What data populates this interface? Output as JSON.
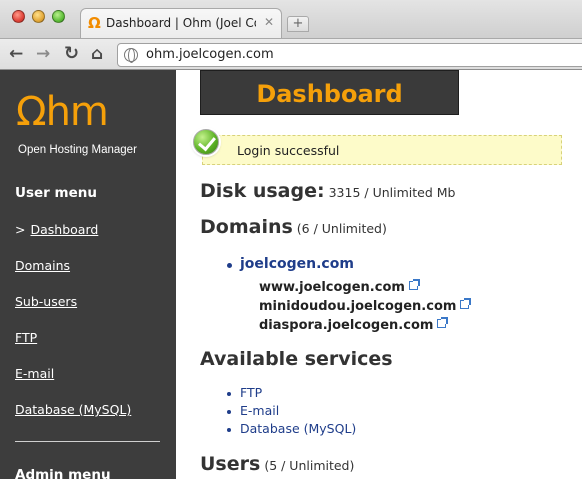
{
  "browser": {
    "tab_title": "Dashboard | Ohm (Joel Cogen)",
    "tab_favicon": "Ω",
    "tab_close": "✕",
    "new_tab": "+",
    "url": "ohm.joelcogen.com",
    "icons": [
      "back-arrow-icon",
      "forward-arrow-icon",
      "reload-icon",
      "home-icon",
      "globe-icon"
    ]
  },
  "sidebar": {
    "logo_mark": "Ωhm",
    "logo_sub": "Open Hosting Manager",
    "user_menu_heading": "User menu",
    "current_prefix": ">",
    "items": [
      {
        "label": "Dashboard"
      },
      {
        "label": "Domains"
      },
      {
        "label": "Sub-users"
      },
      {
        "label": "FTP"
      },
      {
        "label": "E-mail"
      },
      {
        "label": "Database (MySQL)"
      }
    ],
    "admin_menu_heading": "Admin menu"
  },
  "main": {
    "title": "Dashboard",
    "flash": "Login successful",
    "disk": {
      "heading": "Disk usage:",
      "value": "3315 / Unlimited Mb"
    },
    "domains": {
      "heading": "Domains",
      "count": "(6 / Unlimited)",
      "primary": "joelcogen.com",
      "subdomains": [
        "www.joelcogen.com",
        "minidoudou.joelcogen.com",
        "diaspora.joelcogen.com"
      ]
    },
    "services": {
      "heading": "Available services",
      "items": [
        "FTP",
        "E-mail",
        "Database (MySQL)"
      ]
    },
    "users": {
      "heading": "Users",
      "count": "(5 / Unlimited)"
    }
  },
  "colors": {
    "accent": "#f5a00a",
    "sidebar_bg": "#3d3d3d",
    "link": "#1f3d8a",
    "flash_bg": "#fdfbc9"
  }
}
